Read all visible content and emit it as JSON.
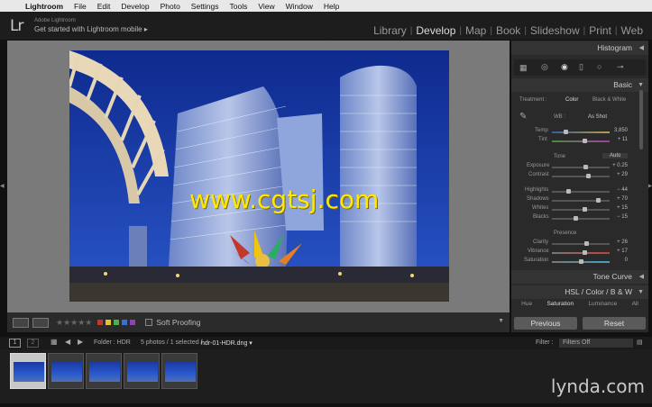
{
  "menubar": {
    "app": "Lightroom",
    "items": [
      "File",
      "Edit",
      "Develop",
      "Photo",
      "Settings",
      "Tools",
      "View",
      "Window",
      "Help"
    ]
  },
  "topbar": {
    "logo": "Lr",
    "adobe_label": "Adobe Lightroom",
    "mobile_label": "Get started with Lightroom mobile ▸",
    "modules": [
      "Library",
      "Develop",
      "Map",
      "Book",
      "Slideshow",
      "Print",
      "Web"
    ],
    "active_module": "Develop"
  },
  "photo": {
    "watermark": "www.cgtsj.com"
  },
  "toolbar": {
    "soft_proofing": "Soft Proofing",
    "color_labels": [
      "#c0392b",
      "#e6c229",
      "#4caf50",
      "#3b6fd0",
      "#8e44ad"
    ]
  },
  "panels": {
    "histogram": "Histogram",
    "basic": "Basic",
    "treatment_label": "Treatment :",
    "treatment_color": "Color",
    "treatment_bw": "Black & White",
    "wb_label": "WB :",
    "wb_value": "As Shot",
    "temp_label": "Temp",
    "temp_value": "3,850",
    "tint_label": "Tint",
    "tint_value": "+ 11",
    "tone_label": "Tone",
    "auto_label": "Auto",
    "exposure_label": "Exposure",
    "exposure_value": "+ 0.25",
    "contrast_label": "Contrast",
    "contrast_value": "+ 29",
    "highlights_label": "Highlights",
    "highlights_value": "− 44",
    "shadows_label": "Shadows",
    "shadows_value": "+ 70",
    "whites_label": "Whites",
    "whites_value": "+ 15",
    "blacks_label": "Blacks",
    "blacks_value": "− 15",
    "presence_label": "Presence",
    "clarity_label": "Clarity",
    "clarity_value": "+ 26",
    "vibrance_label": "Vibrance",
    "vibrance_value": "+ 17",
    "saturation_label": "Saturation",
    "saturation_value": "0",
    "tone_curve": "Tone Curve",
    "hsl_title": "HSL  /  Color  /  B & W",
    "hsl_tabs": [
      "Hue",
      "Saturation",
      "Luminance",
      "All"
    ],
    "previous": "Previous",
    "reset": "Reset"
  },
  "filmstrip": {
    "page1": "1",
    "page2": "2",
    "folder": "Folder : HDR",
    "count": "5 photos / 1 selected /",
    "filename": "hdr-01-HDR.dng ▾",
    "filter_label": "Filter :",
    "filter_value": "Filters Off"
  },
  "brand": "lynda.com"
}
